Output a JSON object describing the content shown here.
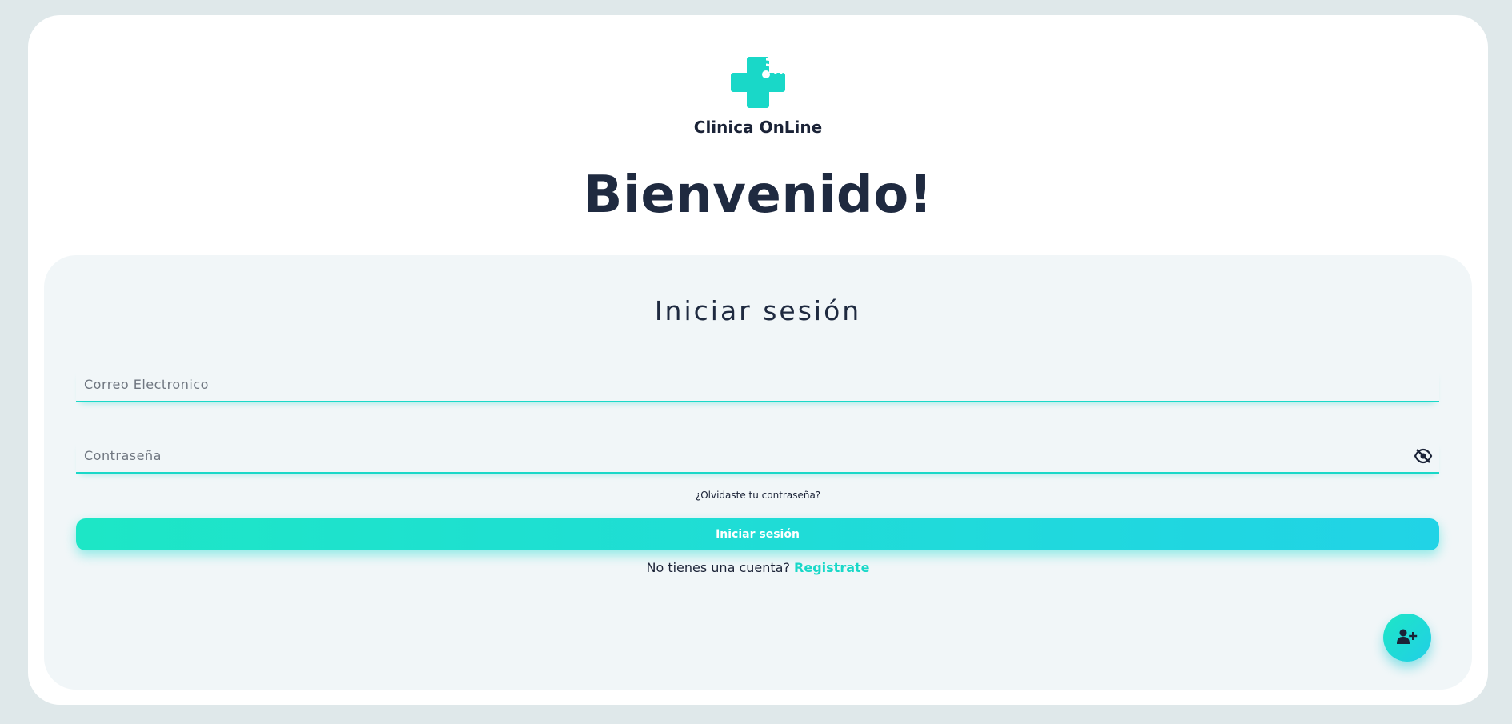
{
  "brand": {
    "name": "Clinica OnLine",
    "logo_icon": "medical-cross-wifi-icon",
    "accent_color": "#19d8c8"
  },
  "welcome": {
    "title": "Bienvenido!"
  },
  "login": {
    "title": "Iniciar sesión",
    "email": {
      "placeholder": "Correo Electronico",
      "value": ""
    },
    "password": {
      "placeholder": "Contraseña",
      "value": "",
      "toggle_icon": "eye-slash-icon"
    },
    "forgot_label": "¿Olvidaste tu contraseña?",
    "submit_label": "Iniciar sesión",
    "signup_prompt": "No tienes una cuenta?",
    "signup_link": "Registrate"
  },
  "fab": {
    "icon": "user-plus-icon"
  }
}
